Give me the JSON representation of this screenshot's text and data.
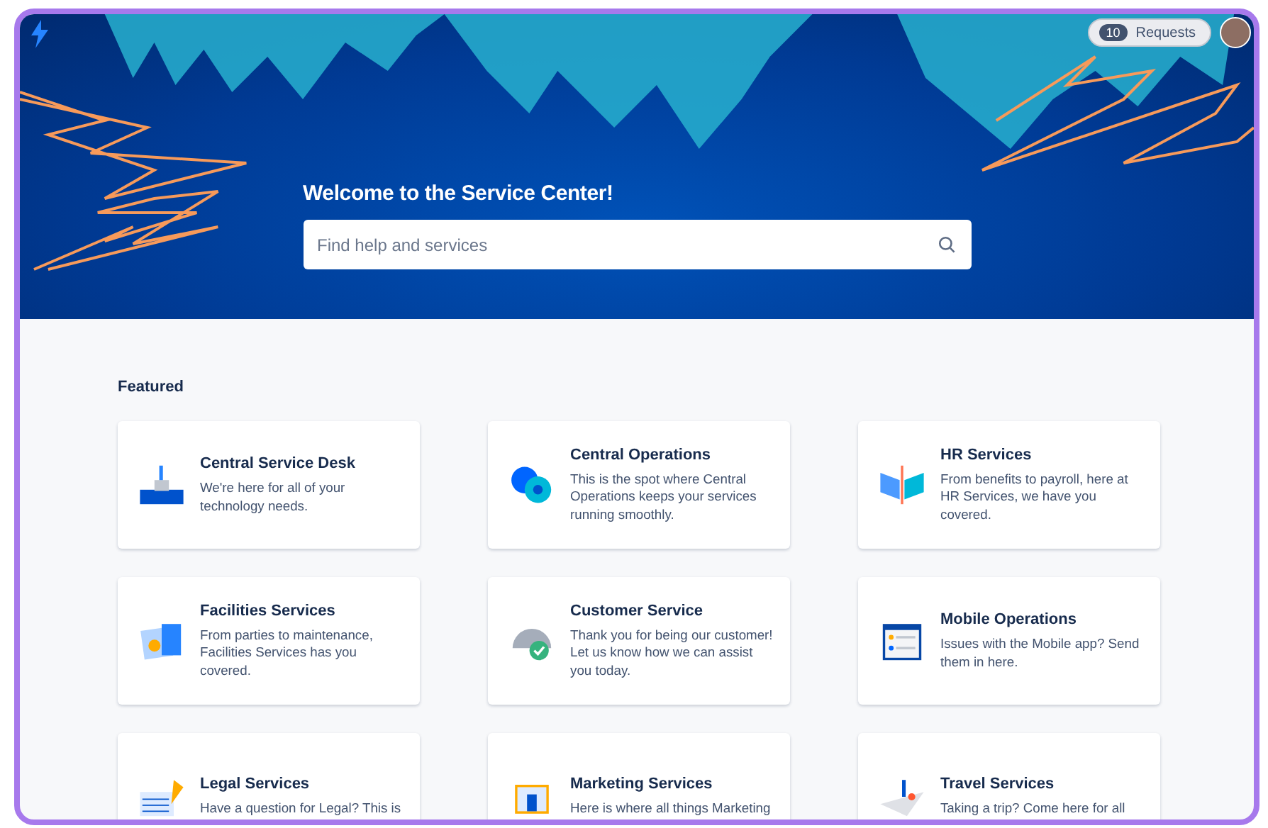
{
  "header": {
    "title": "Welcome to the Service Center!",
    "search": {
      "placeholder": "Find help and services"
    },
    "requests": {
      "count": "10",
      "label": "Requests"
    }
  },
  "featured": {
    "heading": "Featured",
    "cards": [
      {
        "title": "Central Service Desk",
        "description": "We're here for all of your technology needs."
      },
      {
        "title": "Central Operations",
        "description": "This is the spot where Central Operations keeps your services running smoothly."
      },
      {
        "title": "HR Services",
        "description": "From benefits to payroll, here at HR Services, we have you covered."
      },
      {
        "title": "Facilities Services",
        "description": "From parties to maintenance, Facilities Services has you covered."
      },
      {
        "title": "Customer Service",
        "description": "Thank you for being our customer! Let us know how we can assist you today."
      },
      {
        "title": "Mobile Operations",
        "description": "Issues with the Mobile app? Send them in here."
      },
      {
        "title": "Legal Services",
        "description": "Have a question for Legal? This is"
      },
      {
        "title": "Marketing Services",
        "description": "Here is where all things Marketing"
      },
      {
        "title": "Travel Services",
        "description": "Taking a trip? Come here for all"
      }
    ]
  }
}
